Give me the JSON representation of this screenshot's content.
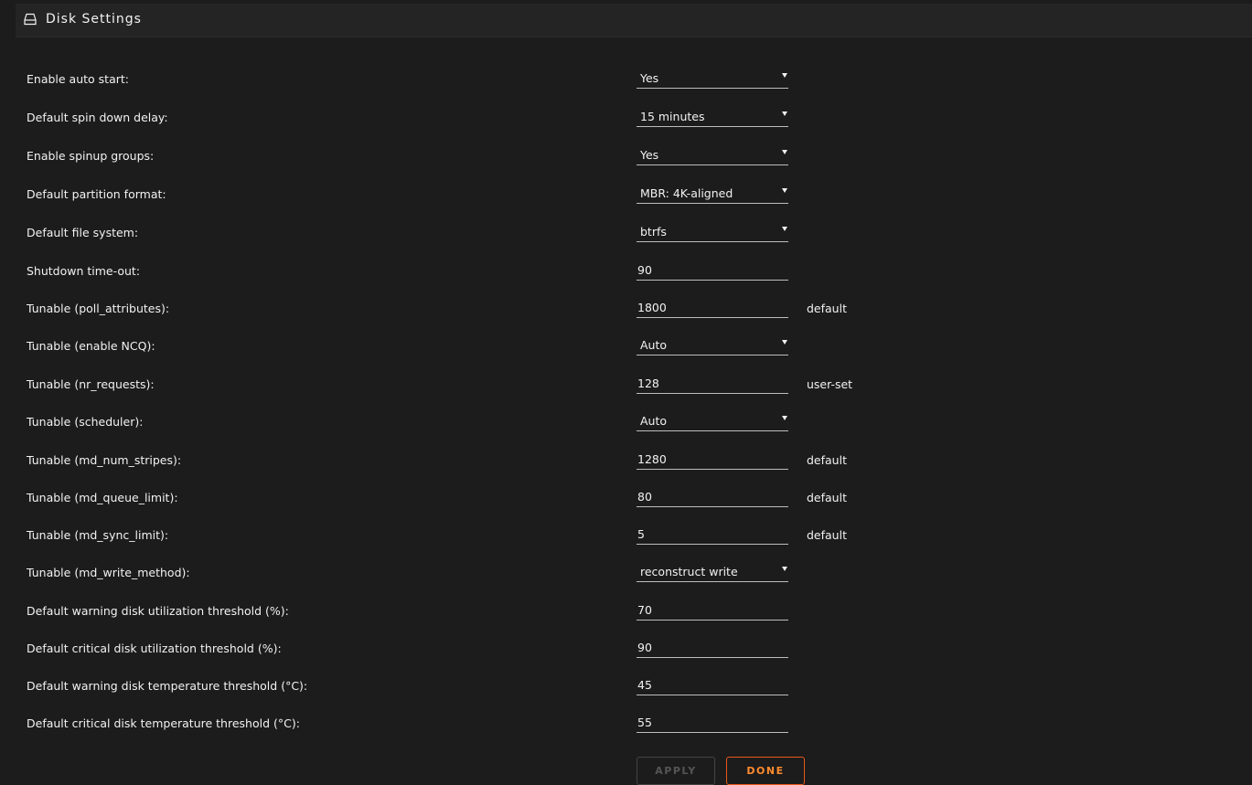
{
  "header": {
    "title": "Disk Settings",
    "icon": "hdd-icon"
  },
  "settings": [
    {
      "label": "Enable auto start:",
      "value": "Yes",
      "type": "select",
      "note": ""
    },
    {
      "label": "Default spin down delay:",
      "value": "15 minutes",
      "type": "select",
      "note": ""
    },
    {
      "label": "Enable spinup groups:",
      "value": "Yes",
      "type": "select",
      "note": ""
    },
    {
      "label": "Default partition format:",
      "value": "MBR: 4K-aligned",
      "type": "select",
      "note": ""
    },
    {
      "label": "Default file system:",
      "value": "btrfs",
      "type": "select",
      "note": ""
    },
    {
      "label": "Shutdown time-out:",
      "value": "90",
      "type": "input",
      "note": ""
    },
    {
      "label": "Tunable (poll_attributes):",
      "value": "1800",
      "type": "input",
      "note": "default"
    },
    {
      "label": "Tunable (enable NCQ):",
      "value": "Auto",
      "type": "select",
      "note": ""
    },
    {
      "label": "Tunable (nr_requests):",
      "value": "128",
      "type": "input",
      "note": "user-set"
    },
    {
      "label": "Tunable (scheduler):",
      "value": "Auto",
      "type": "select",
      "note": ""
    },
    {
      "label": "Tunable (md_num_stripes):",
      "value": "1280",
      "type": "input",
      "note": "default"
    },
    {
      "label": "Tunable (md_queue_limit):",
      "value": "80",
      "type": "input",
      "note": "default"
    },
    {
      "label": "Tunable (md_sync_limit):",
      "value": "5",
      "type": "input",
      "note": "default"
    },
    {
      "label": "Tunable (md_write_method):",
      "value": "reconstruct write",
      "type": "select",
      "note": ""
    },
    {
      "label": "Default warning disk utilization threshold (%):",
      "value": "70",
      "type": "input",
      "note": ""
    },
    {
      "label": "Default critical disk utilization threshold (%):",
      "value": "90",
      "type": "input",
      "note": ""
    },
    {
      "label": "Default warning disk temperature threshold (°C):",
      "value": "45",
      "type": "input",
      "note": ""
    },
    {
      "label": "Default critical disk temperature threshold (°C):",
      "value": "55",
      "type": "input",
      "note": ""
    }
  ],
  "buttons": {
    "apply": "APPLY",
    "done": "DONE"
  },
  "colors": {
    "background": "#1c1c1c",
    "accent": "#ff8c2f",
    "text": "#f2f2f2"
  }
}
